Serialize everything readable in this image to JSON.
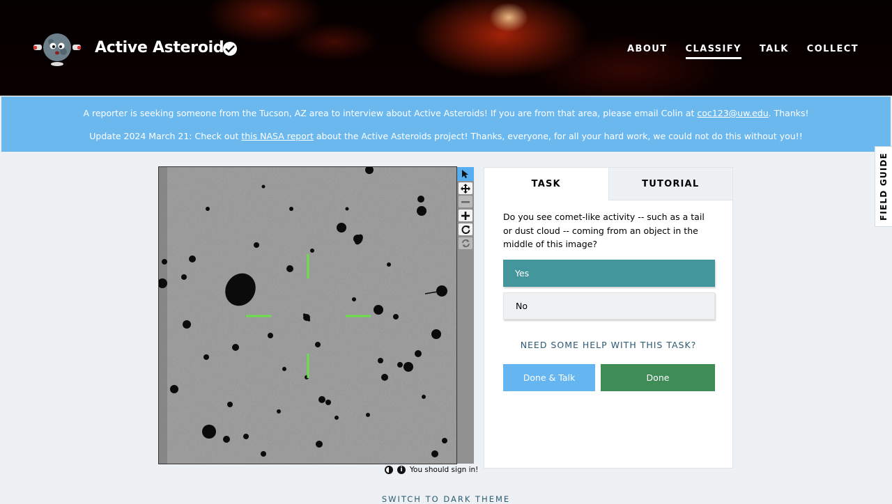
{
  "header": {
    "title": "Active Asteroids",
    "nav": [
      "ABOUT",
      "CLASSIFY",
      "TALK",
      "COLLECT"
    ],
    "active_nav": "CLASSIFY"
  },
  "banner": {
    "line1_text": "A reporter is seeking someone from the Tucson, AZ area to interview about Active Asteroids! If you are from that area, please email Colin at ",
    "line1_link": "coc123@uw.edu",
    "line1_end": ". Thanks!",
    "line2_text": "Update 2024 March 21: Check out ",
    "line2_link": "this NASA report",
    "line2_end": " about the Active Asteroids project! Thanks, everyone, for all your hard work, we could not do this without you!!"
  },
  "field_guide": {
    "label": "FIELD GUIDE"
  },
  "viewer": {
    "signin_text": "You should sign in!",
    "tools": [
      "pointer-icon",
      "move-icon",
      "zoom-out-icon",
      "zoom-in-icon",
      "rotate-icon",
      "reset-icon"
    ]
  },
  "task": {
    "tabs": [
      "TASK",
      "TUTORIAL"
    ],
    "question": "Do you see comet-like activity -- such as a tail or dust cloud -- coming from an object in the middle of this image?",
    "answers": [
      "Yes",
      "No"
    ],
    "selected_answer": "Yes",
    "help_label": "NEED SOME HELP WITH THIS TASK?",
    "done_talk_label": "Done & Talk",
    "done_label": "Done"
  },
  "footer": {
    "theme_toggle": "SWITCH TO DARK THEME"
  },
  "colors": {
    "banner": "#6ab8ee",
    "selected_answer": "#43969b",
    "done": "#3f8c57",
    "done_talk": "#65b5f1",
    "crosshair": "#6be04a"
  }
}
